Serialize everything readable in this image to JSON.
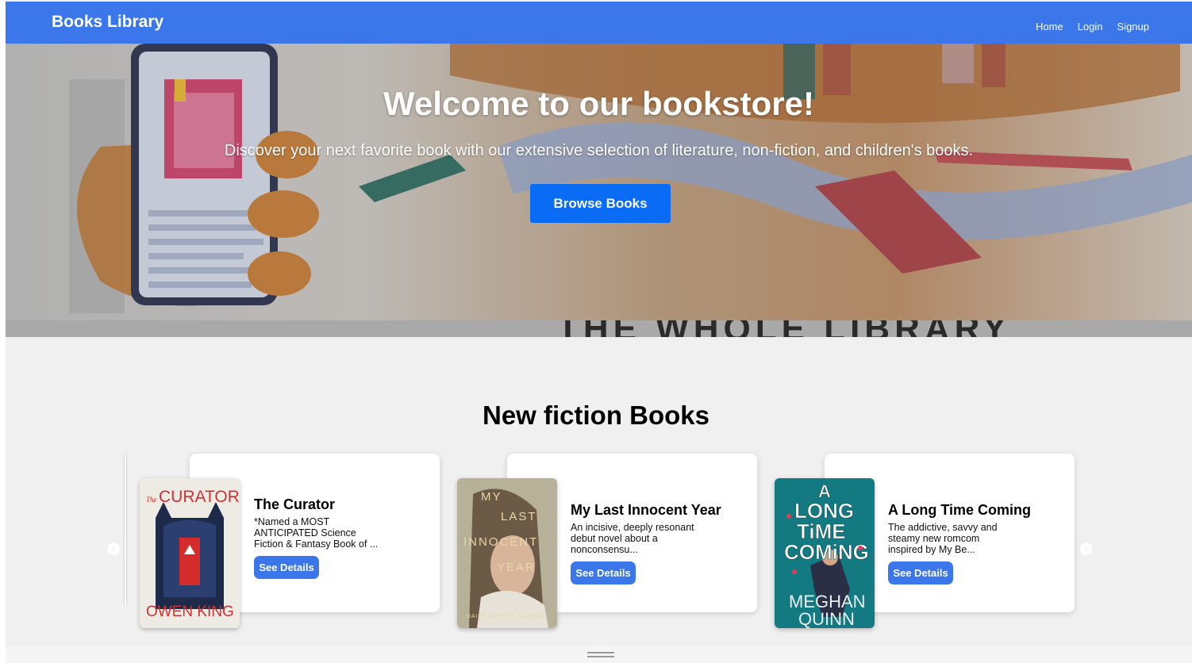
{
  "navbar": {
    "brand": "Books Library",
    "links": [
      "Home",
      "Login",
      "Signup"
    ]
  },
  "hero": {
    "title": "Welcome to our bookstore!",
    "subtitle": "Discover your next favorite book with our extensive selection of literature, non-fiction, and children's books.",
    "button": "Browse Books",
    "strip_text": "THE WHOLE LIBRARY"
  },
  "section": {
    "title": "New fiction Books"
  },
  "books": [
    {
      "title": "The Curator",
      "description": "*Named a MOST ANTICIPATED Science Fiction & Fantasy Book of ...",
      "button": "See Details",
      "cover_title": "CURATOR",
      "cover_prefix": "The",
      "cover_author": "OWEN KING"
    },
    {
      "title": "My Last Innocent Year",
      "description": "An incisive, deeply resonant debut novel about a nonconsensu...",
      "button": "See Details",
      "cover_lines": [
        "MY",
        "LAST",
        "INNOCENT",
        "YEAR"
      ],
      "cover_author": "DAISY ALPERT FLORIN"
    },
    {
      "title": "A Long Time Coming",
      "description": "The addictive, savvy and steamy new romcom inspired by My Be...",
      "button": "See Details",
      "cover_lines": [
        "A",
        "LONG",
        "TiME",
        "COMiNG"
      ],
      "cover_author_lines": [
        "MEGHAN",
        "QUINN"
      ]
    }
  ],
  "colors": {
    "navbar": "#3b77ea",
    "hero_button": "#0a6cf5",
    "details_button": "#3b77ea"
  }
}
